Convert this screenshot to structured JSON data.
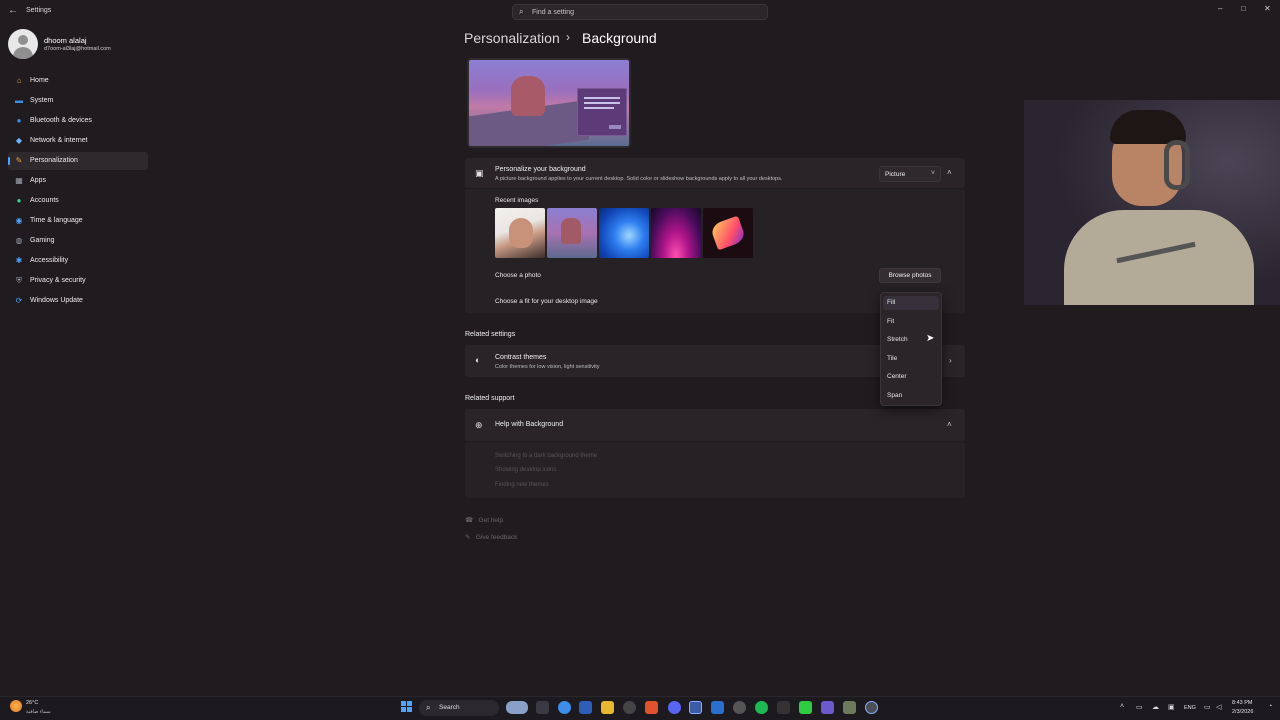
{
  "window": {
    "title": "Settings",
    "search_placeholder": "Find a setting",
    "controls": {
      "minimize": "–",
      "maximize": "□",
      "close": "✕"
    }
  },
  "profile": {
    "name": "dhoom alalaj",
    "email": "d7oom-al3laj@hotmail.com"
  },
  "sidebar": {
    "items": [
      {
        "label": "Home",
        "icon": "home-icon",
        "color": "#e8a33a"
      },
      {
        "label": "System",
        "icon": "system-icon",
        "color": "#3a8ee6"
      },
      {
        "label": "Bluetooth & devices",
        "icon": "bluetooth-icon",
        "color": "#3a8ee6"
      },
      {
        "label": "Network & internet",
        "icon": "wifi-icon",
        "color": "#6fb6ff"
      },
      {
        "label": "Personalization",
        "icon": "brush-icon",
        "color": "#e8a33a",
        "active": true
      },
      {
        "label": "Apps",
        "icon": "apps-icon",
        "color": "#9aa3b0"
      },
      {
        "label": "Accounts",
        "icon": "accounts-icon",
        "color": "#3ccf8e"
      },
      {
        "label": "Time & language",
        "icon": "globe-clock-icon",
        "color": "#4fa3ff"
      },
      {
        "label": "Gaming",
        "icon": "gaming-icon",
        "color": "#9aa3b0"
      },
      {
        "label": "Accessibility",
        "icon": "accessibility-icon",
        "color": "#4fa3ff"
      },
      {
        "label": "Privacy & security",
        "icon": "shield-icon",
        "color": "#9aa3b0"
      },
      {
        "label": "Windows Update",
        "icon": "update-icon",
        "color": "#4fa3ff"
      }
    ]
  },
  "breadcrumb": {
    "parent": "Personalization",
    "separator": "›",
    "current": "Background"
  },
  "background_card": {
    "title": "Personalize your background",
    "subtitle": "A picture background applies to your current desktop. Solid color or slideshow backgrounds apply to all your desktops.",
    "type_value": "Picture",
    "recent_label": "Recent images",
    "choose_photo_label": "Choose a photo",
    "browse_label": "Browse photos",
    "fit_label": "Choose a fit for your desktop image",
    "fit_options": [
      "Fill",
      "Fit",
      "Stretch",
      "Tile",
      "Center",
      "Span"
    ],
    "fit_selected": "Fill"
  },
  "related_settings": {
    "heading": "Related settings",
    "contrast_title": "Contrast themes",
    "contrast_subtitle": "Color themes for low vision, light sensitivity"
  },
  "related_support": {
    "heading": "Related support",
    "help_title": "Help with Background",
    "links": [
      "Switching to a dark background theme",
      "Showing desktop icons",
      "Finding new themes"
    ]
  },
  "footer": {
    "get_help": "Get help",
    "give_feedback": "Give feedback"
  },
  "taskbar": {
    "weather_temp": "26°C",
    "weather_desc": "سماء صافية",
    "search_label": "Search",
    "language": "ENG",
    "time": "8:43 PM",
    "date": "2/3/2026",
    "accent": "#4fa3ff"
  }
}
